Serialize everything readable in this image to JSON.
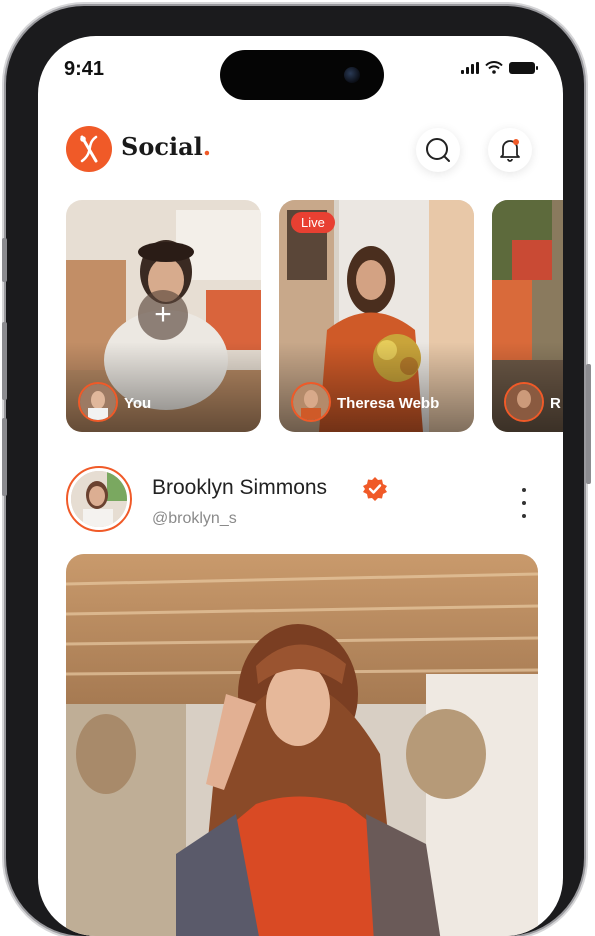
{
  "status_bar": {
    "time": "9:41"
  },
  "header": {
    "brand_name": "Social",
    "brand_dot": ".",
    "accent_color": "#f05a28",
    "logo_icon": "needle-thread-logo",
    "search_icon": "search-icon",
    "bell_icon": "bell-icon"
  },
  "stories": [
    {
      "name": "You",
      "add_label": "+"
    },
    {
      "name": "Theresa Webb",
      "badge": "Live"
    },
    {
      "name": "R"
    }
  ],
  "post": {
    "author_name": "Brooklyn Simmons",
    "author_handle": "@broklyn_s",
    "verified_icon": "verified-badge-icon",
    "more_icon": "more-vertical-icon"
  }
}
